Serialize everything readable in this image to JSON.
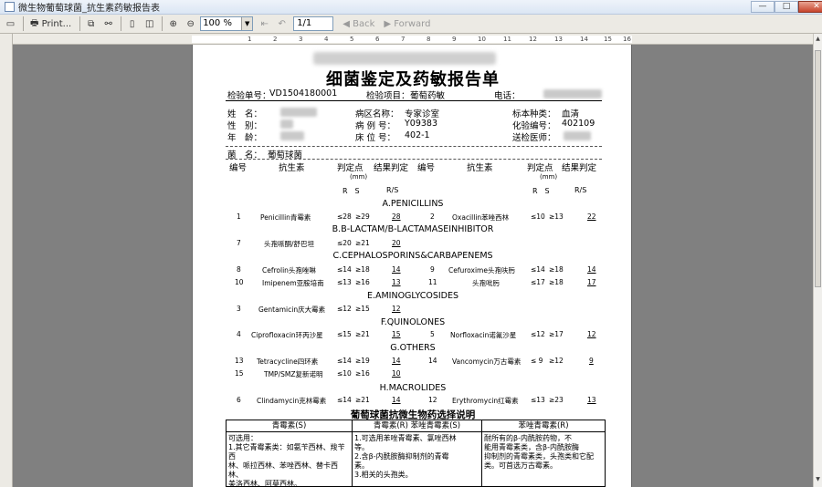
{
  "window": {
    "title": "微生物葡萄球菌_抗生素药敏报告表",
    "buttons": [
      "—",
      "□",
      "✕"
    ]
  },
  "toolbar": {
    "print_label": "Print...",
    "zoom_value": "100 %",
    "page_value": "1/1",
    "back_label": "Back",
    "forward_label": "Forward",
    "icons": [
      "page-setup-icon",
      "print-icon",
      "copy-icon",
      "find-icon",
      "single-page-icon",
      "multi-page-icon",
      "zoom-in-icon",
      "zoom-out-icon",
      "first-page-icon",
      "prev-page-icon",
      "back-icon",
      "forward-icon"
    ]
  },
  "ruler": {
    "ticks": [
      "1",
      "2",
      "3",
      "4",
      "5",
      "6",
      "7",
      "8",
      "9",
      "10",
      "11",
      "12",
      "13",
      "14",
      "15",
      "16"
    ]
  },
  "report": {
    "title": "细菌鉴定及药敏报告单",
    "header_row": {
      "sample_no_label": "检验单号：",
      "sample_no": "VD1504180001",
      "item_label": "检验项目：",
      "item": "葡萄药敏",
      "phone_label": "电话："
    },
    "patient": {
      "name_label": "姓　名：",
      "sex_label": "性　别：",
      "age_label": "年　龄：",
      "ward_label": "病区名称：",
      "ward": "专家诊室",
      "case_label": "病 例 号：",
      "case_no": "Y09383",
      "bed_label": "床 位 号：",
      "bed": "402-1",
      "specimen_label": "标本种类：",
      "specimen": "血清",
      "lab_label": "化验编号：",
      "lab_no": "402109",
      "doctor_label": "送检医师："
    },
    "bacteria_label": "菌　名：",
    "bacteria": "葡萄球菌",
    "table_headers": {
      "no": "编号",
      "antibiotic": "抗生素",
      "breakpoint": "判定点",
      "mm": "(mm)",
      "result": "结果判定",
      "rs": "R　S",
      "rs2": "R/S"
    },
    "sections": [
      "A.PENICILLINS",
      "B.B-LACTAM/B-LACTAMASEINHIBITOR",
      "C.CEPHALOSPORINS&CARBAPENEMS",
      "E.AMINOGLYCOSIDES",
      "F.QUINOLONES",
      "G.OTHERS",
      "H.MACROLIDES"
    ],
    "rows": [
      {
        "no": "1",
        "name": "Penicillin青霉素",
        "r": "≤28",
        "s": "≥29",
        "res": "28"
      },
      {
        "no": "2",
        "name": "Oxacillin苯唑西林",
        "r": "≤10",
        "s": "≥13",
        "res": "22"
      },
      {
        "no": "7",
        "name": "头孢哌酮/舒巴坦",
        "r": "≤20",
        "s": "≥21",
        "res": "20"
      },
      {
        "no": "8",
        "name": "Cefrolin头孢唑啉",
        "r": "≤14",
        "s": "≥18",
        "res": "14"
      },
      {
        "no": "9",
        "name": "Cefuroxime头孢呋肟",
        "r": "≤14",
        "s": "≥18",
        "res": "14"
      },
      {
        "no": "10",
        "name": "Imipenem亚胺培南",
        "r": "≤13",
        "s": "≥16",
        "res": "13"
      },
      {
        "no": "11",
        "name": "头孢吡肟",
        "r": "≤17",
        "s": "≥18",
        "res": "17"
      },
      {
        "no": "3",
        "name": "Gentamicin庆大霉素",
        "r": "≤12",
        "s": "≥15",
        "res": "12"
      },
      {
        "no": "4",
        "name": "Ciprofloxacin环丙沙星",
        "r": "≤15",
        "s": "≥21",
        "res": "15"
      },
      {
        "no": "5",
        "name": "Norfloxacin诺氟沙星",
        "r": "≤12",
        "s": "≥17",
        "res": "12"
      },
      {
        "no": "13",
        "name": "Tetracycline四环素",
        "r": "≤14",
        "s": "≥19",
        "res": "14"
      },
      {
        "no": "14",
        "name": "Vancomycin万古霉素",
        "r": "≤ 9",
        "s": "≥12",
        "res": "9"
      },
      {
        "no": "15",
        "name": "TMP/SMZ复新诺明",
        "r": "≤10",
        "s": "≥16",
        "res": "10"
      },
      {
        "no": "6",
        "name": "Clindamycin克林霉素",
        "r": "≤14",
        "s": "≥21",
        "res": "14"
      },
      {
        "no": "12",
        "name": "Erythromycin红霉素",
        "r": "≤13",
        "s": "≥23",
        "res": "13"
      }
    ],
    "legend_title": "葡萄球菌抗微生物药选择说明",
    "legend_cols": [
      {
        "head": "青霉素(S)",
        "body": "可选用：\n1.其它青霉素类：如氨苄西林、羧苄西\n林、哌拉西林、苯唑西林、替卡西林、\n美洛西林、阿莫西林。"
      },
      {
        "head": "青霉素(R) 苯唑青霉素(S)",
        "body": "1.可选用苯唑青霉素、氯唑西林\n等。\n2.含β-内酰胺酶抑制剂的青霉\n素。\n3.相关的头孢类。"
      },
      {
        "head": "苯唑青霉素(R)",
        "body": "耐所有的β-内酰胺药物，不\n能用青霉素类，含β-内酰胺酶\n抑制剂的青霉素类，头孢类和它配\n类。可首选万古霉素。"
      }
    ]
  }
}
